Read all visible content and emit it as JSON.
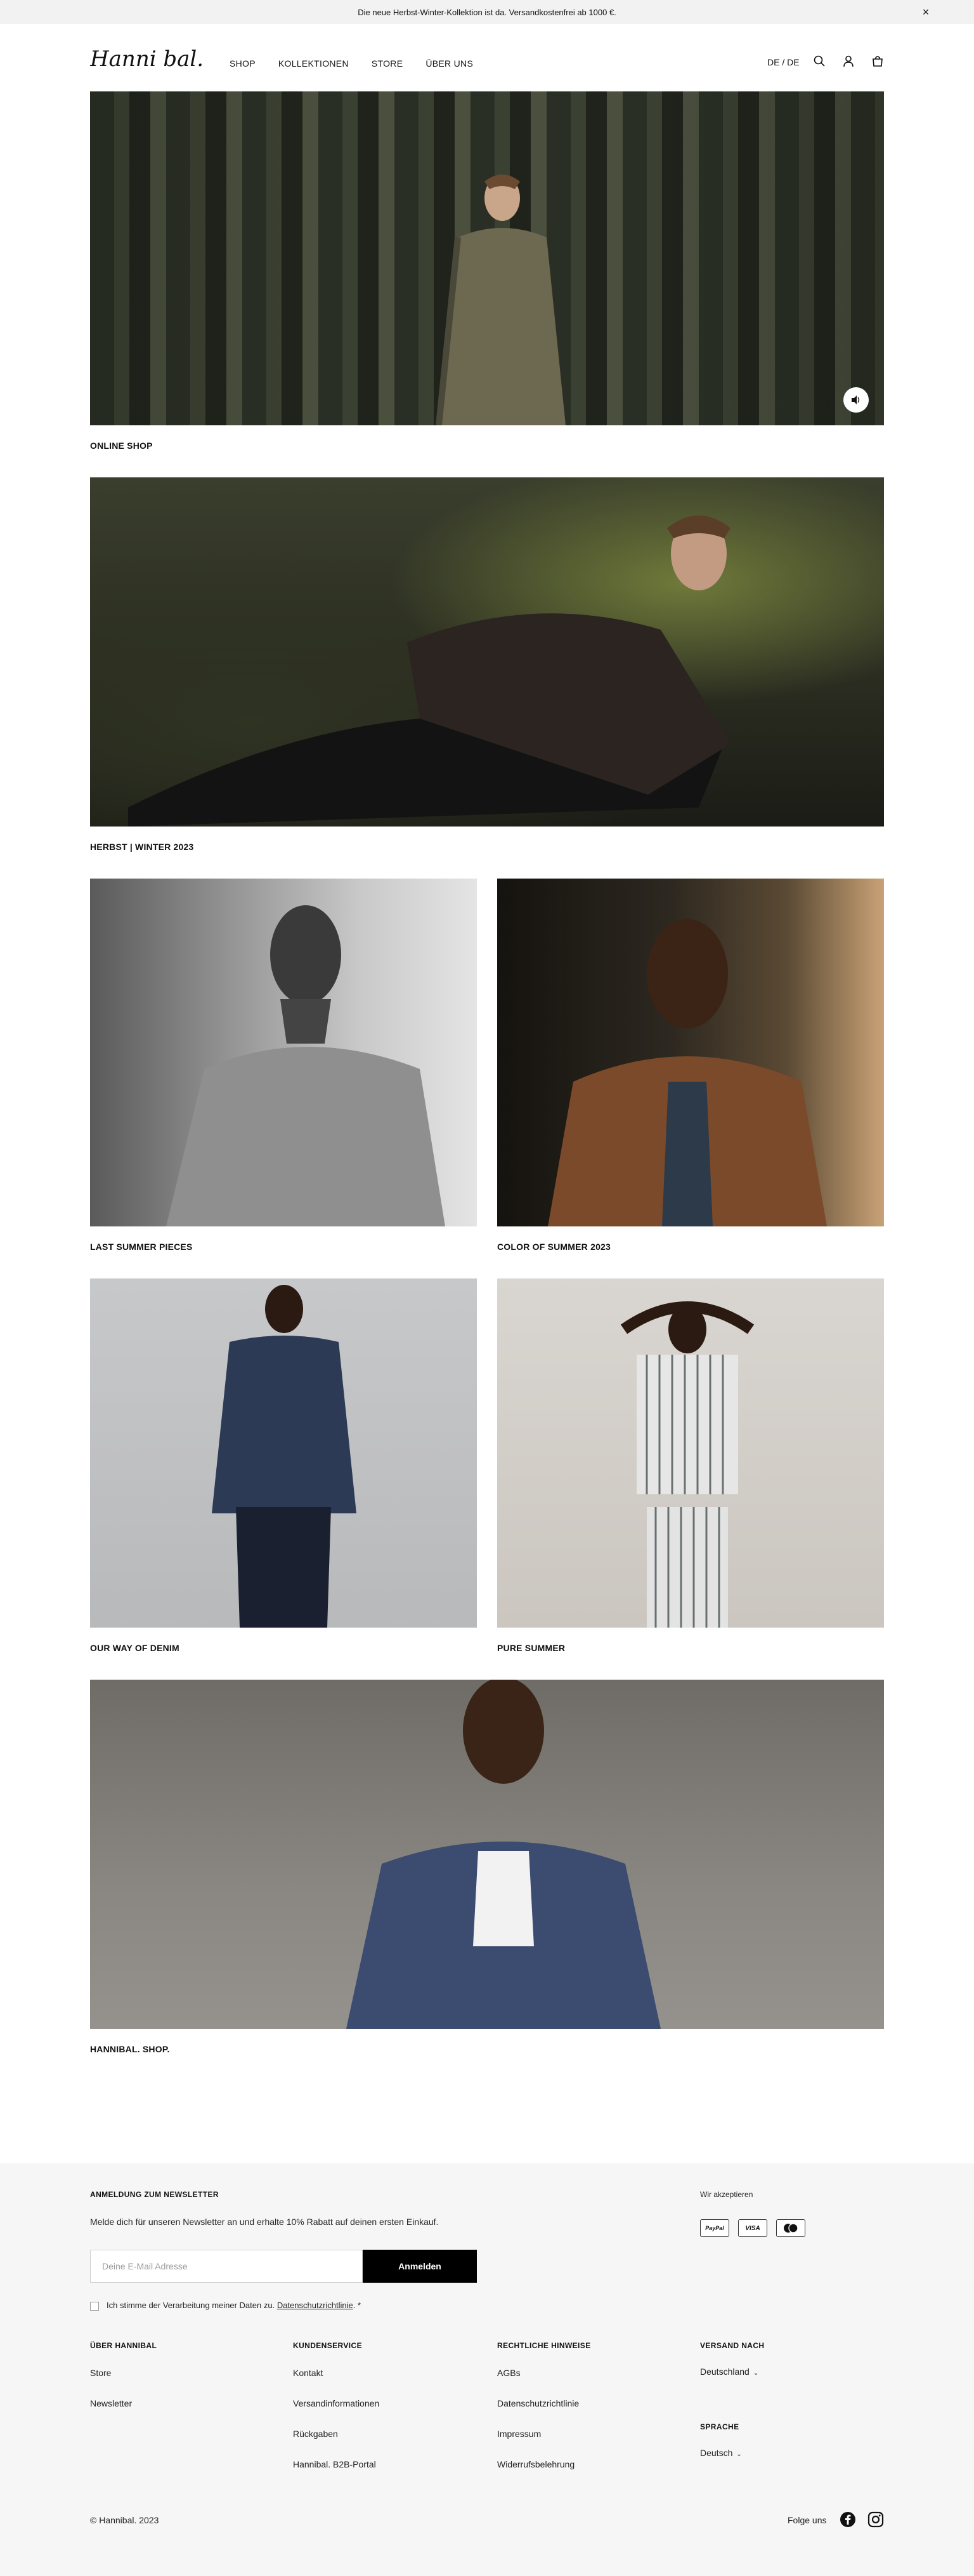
{
  "announcement": {
    "text": "Die neue Herbst-Winter-Kollektion ist da. Versandkostenfrei ab 1000 €.",
    "close_icon": "close-icon"
  },
  "header": {
    "logo_text": "Hanni bal.",
    "nav": [
      "SHOP",
      "KOLLEKTIONEN",
      "STORE",
      "ÜBER UNS"
    ],
    "lang": "DE / DE",
    "icons": [
      "search-icon",
      "user-icon",
      "bag-icon"
    ]
  },
  "tiles": {
    "online_shop": "ONLINE SHOP",
    "herbst": "HERBST | WINTER 2023",
    "last_summer": "LAST SUMMER PIECES",
    "color_summer": "COLOR OF SUMMER 2023",
    "denim": "OUR WAY OF DENIM",
    "pure_summer": "PURE SUMMER",
    "hannibal_shop": "HANNIBAL. SHOP."
  },
  "footer": {
    "newsletter": {
      "heading": "ANMELDUNG ZUM NEWSLETTER",
      "text": "Melde dich für unseren Newsletter an und erhalte 10% Rabatt auf deinen ersten Einkauf.",
      "placeholder": "Deine E-Mail Adresse",
      "button": "Anmelden",
      "consent_prefix": "Ich stimme der Verarbeitung meiner Daten zu.",
      "consent_link": "Datenschutzrichtlinie",
      "consent_suffix": ". *"
    },
    "payments": {
      "heading": "Wir akzeptieren",
      "methods": [
        "PayPal",
        "VISA",
        "Mastercard"
      ]
    },
    "columns": [
      {
        "heading": "ÜBER HANNIBAL",
        "links": [
          "Store",
          "Newsletter"
        ]
      },
      {
        "heading": "KUNDENSERVICE",
        "links": [
          "Kontakt",
          "Versandinformationen",
          "Rückgaben",
          "Hannibal. B2B-Portal"
        ]
      },
      {
        "heading": "RECHTLICHE HINWEISE",
        "links": [
          "AGBs",
          "Datenschutzrichtlinie",
          "Impressum",
          "Widerrufsbelehrung"
        ]
      }
    ],
    "shipping": {
      "heading": "VERSAND NACH",
      "value": "Deutschland"
    },
    "language": {
      "heading": "SPRACHE",
      "value": "Deutsch"
    },
    "copyright": "© Hannibal. 2023",
    "follow": "Folge uns",
    "social_icons": [
      "facebook-icon",
      "instagram-icon"
    ]
  }
}
